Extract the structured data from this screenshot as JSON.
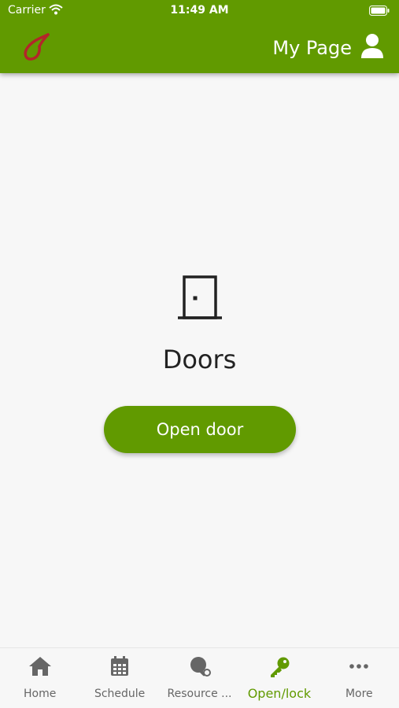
{
  "status_bar": {
    "carrier": "Carrier",
    "time": "11:49 AM"
  },
  "header": {
    "my_page_label": "My Page",
    "user_icon": "user-icon",
    "logo_icon": "drop-logo-icon"
  },
  "main": {
    "icon": "door-icon",
    "title": "Doors",
    "open_button_label": "Open door"
  },
  "tabbar": {
    "items": [
      {
        "label": "Home",
        "icon": "home-icon",
        "active": false
      },
      {
        "label": "Schedule",
        "icon": "calendar-icon",
        "active": false
      },
      {
        "label": "Resource ...",
        "icon": "table-tennis-icon",
        "active": false
      },
      {
        "label": "Open/lock",
        "icon": "key-icon",
        "active": true
      },
      {
        "label": "More",
        "icon": "more-dots-icon",
        "active": false
      }
    ]
  },
  "colors": {
    "brand_green": "#619a00",
    "logo_red": "#b3262a",
    "inactive_gray": "#666666"
  }
}
